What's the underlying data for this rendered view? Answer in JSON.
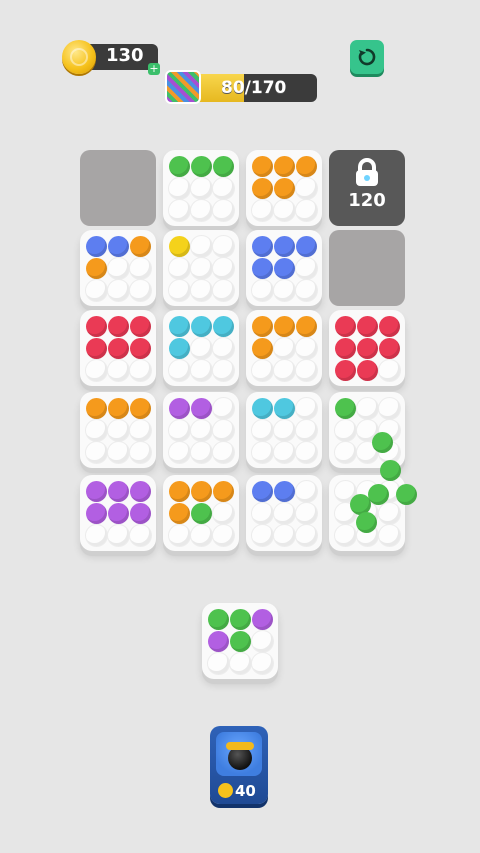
{
  "hud": {
    "coins": "130",
    "progress_text": "80/170",
    "progress_current": 80,
    "progress_total": 170,
    "coin_plus_icon": "plus-icon",
    "restart_icon": "restart-icon"
  },
  "colors": {
    "green": "#4ec24e",
    "orange": "#f59a1c",
    "blue": "#5d7ef0",
    "yellow": "#f4d21b",
    "red": "#ea3a55",
    "cyan": "#4fc8e0",
    "purple": "#b25fe2",
    "white": "#fdfdfd"
  },
  "board": {
    "rows": [
      [
        {
          "kind": "empty"
        },
        {
          "kind": "tile",
          "balls": [
            "green",
            "green",
            "green",
            "white",
            "white",
            "white",
            "white",
            "white",
            "white"
          ]
        },
        {
          "kind": "tile",
          "balls": [
            "orange",
            "orange",
            "orange",
            "orange",
            "orange",
            "white",
            "white",
            "white",
            "white"
          ]
        },
        {
          "kind": "locked",
          "cost": "120",
          "icon": "lock-icon"
        }
      ],
      [
        {
          "kind": "tile",
          "balls": [
            "blue",
            "blue",
            "orange",
            "orange",
            "white",
            "white",
            "white",
            "white",
            "white"
          ]
        },
        {
          "kind": "tile",
          "balls": [
            "yellow",
            "white",
            "white",
            "white",
            "white",
            "white",
            "white",
            "white",
            "white"
          ]
        },
        {
          "kind": "tile",
          "balls": [
            "blue",
            "blue",
            "blue",
            "blue",
            "blue",
            "white",
            "white",
            "white",
            "white"
          ]
        },
        {
          "kind": "empty"
        }
      ],
      [
        {
          "kind": "tile",
          "balls": [
            "red",
            "red",
            "red",
            "red",
            "red",
            "red",
            "white",
            "white",
            "white"
          ]
        },
        {
          "kind": "tile",
          "balls": [
            "cyan",
            "cyan",
            "cyan",
            "cyan",
            "white",
            "white",
            "white",
            "white",
            "white"
          ]
        },
        {
          "kind": "tile",
          "balls": [
            "orange",
            "orange",
            "orange",
            "orange",
            "white",
            "white",
            "white",
            "white",
            "white"
          ]
        },
        {
          "kind": "tile",
          "balls": [
            "red",
            "red",
            "red",
            "red",
            "red",
            "red",
            "red",
            "red",
            "white"
          ]
        }
      ],
      [
        {
          "kind": "tile",
          "balls": [
            "orange",
            "orange",
            "orange",
            "white",
            "white",
            "white",
            "white",
            "white",
            "white"
          ]
        },
        {
          "kind": "tile",
          "balls": [
            "purple",
            "purple",
            "white",
            "white",
            "white",
            "white",
            "white",
            "white",
            "white"
          ]
        },
        {
          "kind": "tile",
          "balls": [
            "cyan",
            "cyan",
            "white",
            "white",
            "white",
            "white",
            "white",
            "white",
            "white"
          ]
        },
        {
          "kind": "tile",
          "balls": [
            "green",
            "white",
            "white",
            "white",
            "white",
            "white",
            "white",
            "white",
            "white"
          ]
        }
      ],
      [
        {
          "kind": "tile",
          "balls": [
            "purple",
            "purple",
            "purple",
            "purple",
            "purple",
            "purple",
            "white",
            "white",
            "white"
          ]
        },
        {
          "kind": "tile",
          "balls": [
            "orange",
            "orange",
            "orange",
            "orange",
            "green",
            "white",
            "white",
            "white",
            "white"
          ]
        },
        {
          "kind": "tile",
          "balls": [
            "blue",
            "blue",
            "white",
            "white",
            "white",
            "white",
            "white",
            "white",
            "white"
          ]
        },
        {
          "kind": "tile",
          "balls": [
            "white",
            "white",
            "white",
            "white",
            "white",
            "white",
            "white",
            "white",
            "white"
          ]
        }
      ]
    ],
    "flying_balls": [
      "green",
      "green",
      "green",
      "green",
      "green",
      "green"
    ]
  },
  "queue": {
    "balls": [
      "green",
      "green",
      "purple",
      "purple",
      "green",
      "white",
      "white",
      "white",
      "white"
    ]
  },
  "powerup": {
    "icon": "bomb-icon",
    "cost": "40",
    "cost_icon": "coin-icon"
  }
}
